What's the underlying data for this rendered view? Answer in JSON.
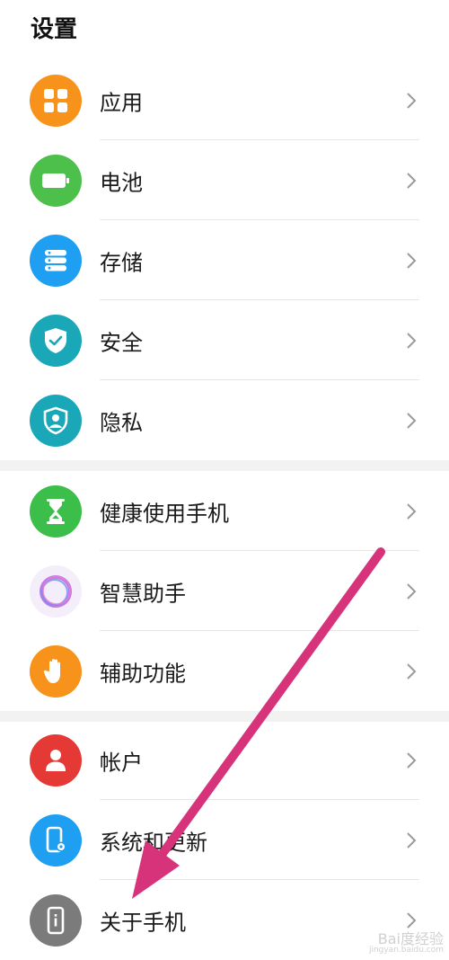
{
  "header": {
    "title": "设置"
  },
  "groups": [
    {
      "items": [
        {
          "label": "应用",
          "icon": "apps-grid-icon",
          "color": "#f7931a"
        },
        {
          "label": "电池",
          "icon": "battery-icon",
          "color": "#4cc04b"
        },
        {
          "label": "存储",
          "icon": "storage-icon",
          "color": "#1e9ff2"
        },
        {
          "label": "安全",
          "icon": "shield-check-icon",
          "color": "#1aa7b8"
        },
        {
          "label": "隐私",
          "icon": "privacy-shield-icon",
          "color": "#1aa7b8"
        }
      ]
    },
    {
      "items": [
        {
          "label": "健康使用手机",
          "icon": "hourglass-icon",
          "color": "#3cbf4a"
        },
        {
          "label": "智慧助手",
          "icon": "assistant-ring-icon",
          "color": "#b779e6"
        },
        {
          "label": "辅助功能",
          "icon": "hand-icon",
          "color": "#f7931a"
        }
      ]
    },
    {
      "items": [
        {
          "label": "帐户",
          "icon": "account-icon",
          "color": "#e53935"
        },
        {
          "label": "系统和更新",
          "icon": "system-update-icon",
          "color": "#1e9ff2"
        },
        {
          "label": "关于手机",
          "icon": "phone-info-icon",
          "color": "#7b7b7b"
        }
      ]
    }
  ],
  "annotation": {
    "arrow_color": "#d6337a"
  },
  "watermark": {
    "text": "Bai度经验",
    "sub": "jingyan.baidu.com"
  }
}
